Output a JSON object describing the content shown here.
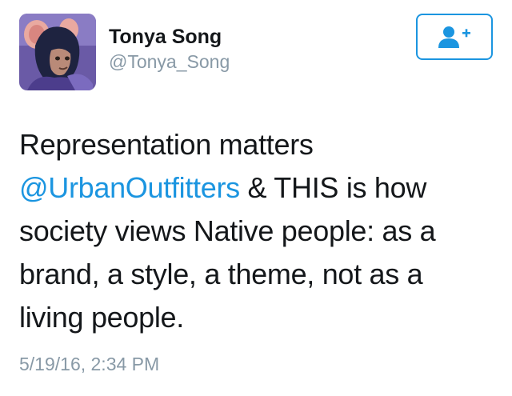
{
  "user": {
    "display_name": "Tonya Song",
    "handle": "@Tonya_Song"
  },
  "follow_button": {
    "icon": "follow-user-plus-icon",
    "color": "#1b95e0"
  },
  "tweet": {
    "lines": [
      {
        "plain": "Representation matters"
      },
      {
        "mention": "@UrbanOutfitters",
        "plain": " & THIS is how"
      },
      {
        "plain": "society views Native people: as a"
      },
      {
        "plain": "brand, a style, a theme, not as a"
      },
      {
        "plain": "living people."
      }
    ],
    "timestamp": "5/19/16, 2:34 PM"
  },
  "colors": {
    "accent": "#1b95e0",
    "text": "#14171a",
    "secondary": "#8899a6"
  }
}
